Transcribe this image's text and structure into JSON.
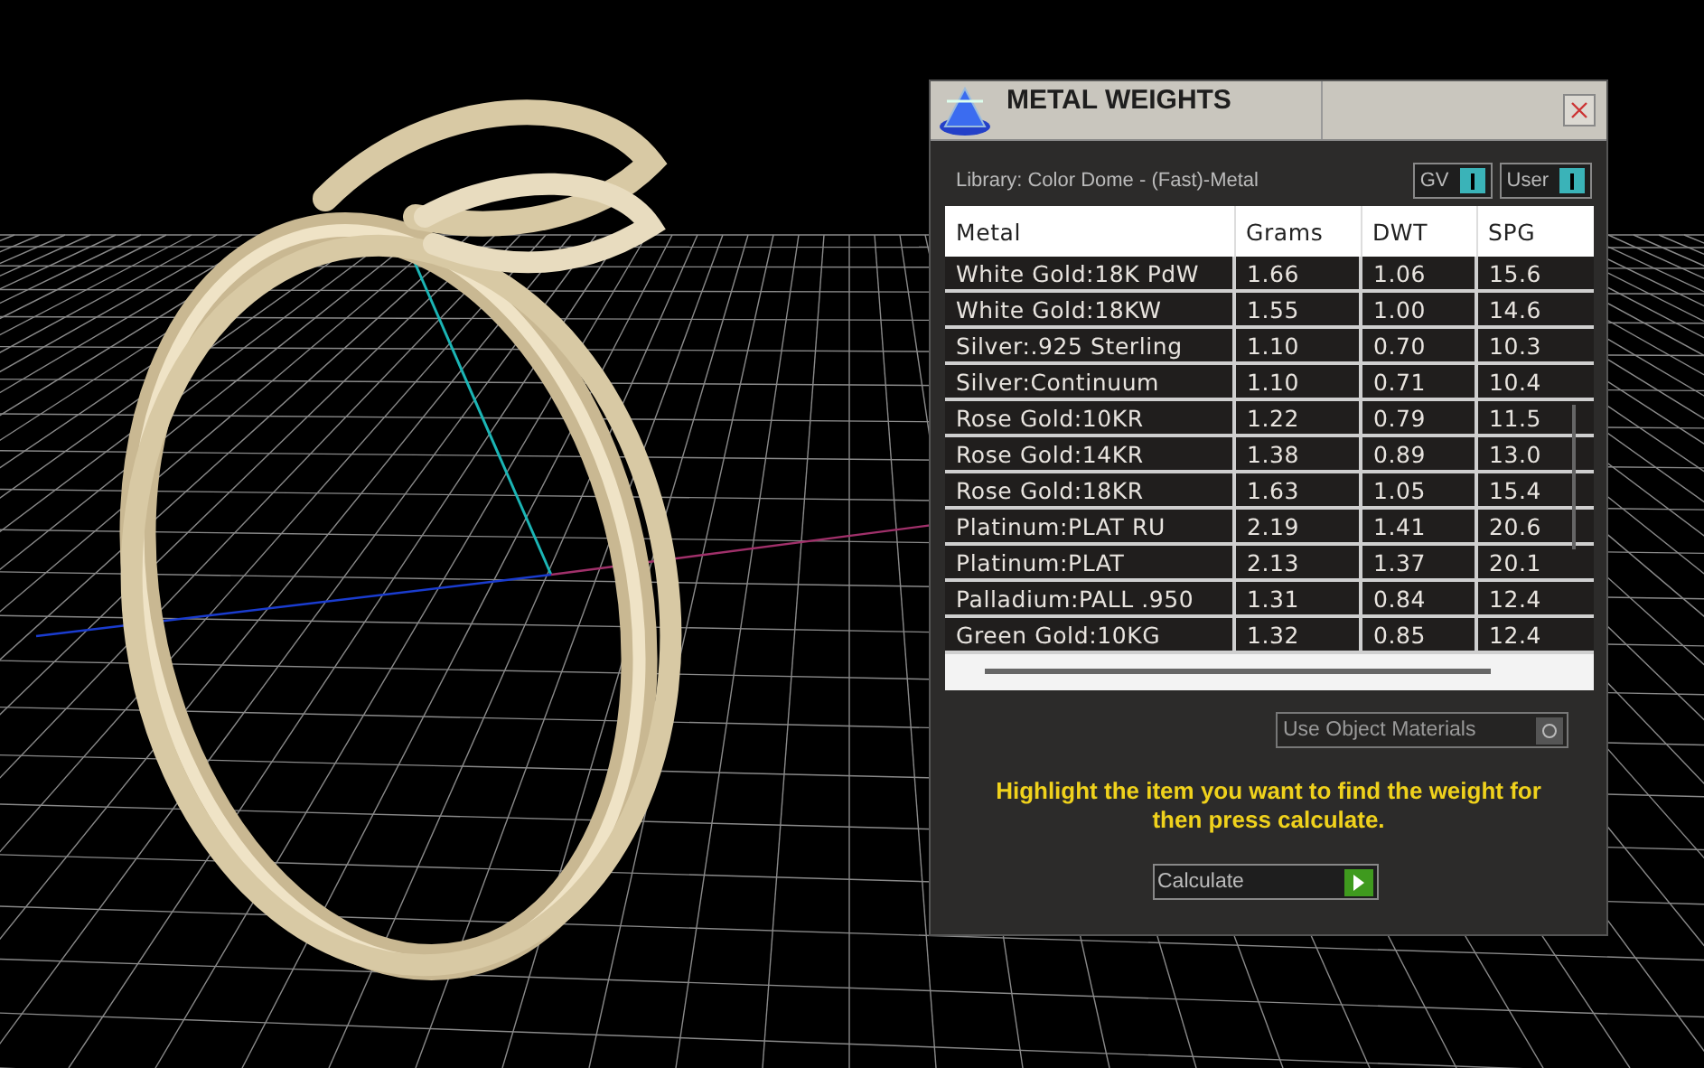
{
  "panel": {
    "title": "METAL WEIGHTS",
    "library": "Library: Color Dome - (Fast)-Metal",
    "toggles": [
      {
        "label": "GV",
        "on": true
      },
      {
        "label": "User",
        "on": true
      }
    ],
    "table": {
      "columns": [
        "Metal",
        "Grams",
        "DWT",
        "SPG"
      ],
      "rows": [
        [
          "White Gold:18K PdW",
          "1.66",
          "1.06",
          "15.6"
        ],
        [
          "White Gold:18KW",
          "1.55",
          "1.00",
          "14.6"
        ],
        [
          "Silver:.925 Sterling",
          "1.10",
          "0.70",
          "10.3"
        ],
        [
          "Silver:Continuum",
          "1.10",
          "0.71",
          "10.4"
        ],
        [
          "Rose Gold:10KR",
          "1.22",
          "0.79",
          "11.5"
        ],
        [
          "Rose Gold:14KR",
          "1.38",
          "0.89",
          "13.0"
        ],
        [
          "Rose Gold:18KR",
          "1.63",
          "1.05",
          "15.4"
        ],
        [
          "Platinum:PLAT RU",
          "2.19",
          "1.41",
          "20.6"
        ],
        [
          "Platinum:PLAT",
          "2.13",
          "1.37",
          "20.1"
        ],
        [
          "Palladium:PALL .950",
          "1.31",
          "0.84",
          "12.4"
        ],
        [
          "Green Gold:10KG",
          "1.32",
          "0.85",
          "12.4"
        ]
      ]
    },
    "use_object_materials": {
      "label": "Use Object Materials",
      "checked": false
    },
    "hint": "Highlight the item you want to find the weight for then press calculate.",
    "calculate_button": "Calculate"
  }
}
